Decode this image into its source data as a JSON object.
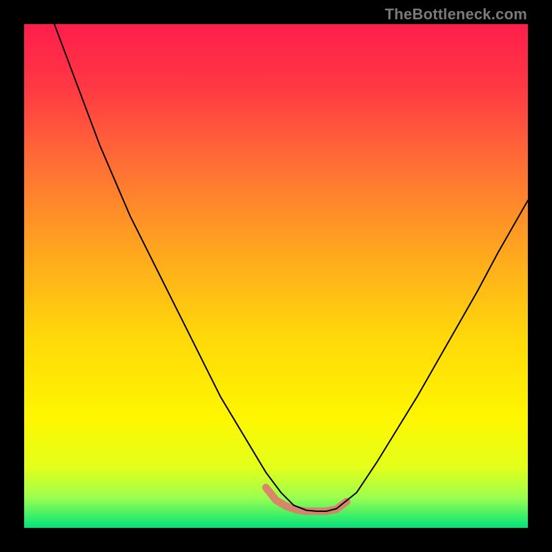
{
  "watermark": {
    "text": "TheBottleneck.com"
  },
  "chart_data": {
    "type": "line",
    "title": "",
    "xlabel": "",
    "ylabel": "",
    "grid": false,
    "legend": false,
    "xlim": [
      0,
      1
    ],
    "ylim": [
      0,
      1
    ],
    "background_gradient": {
      "direction": "vertical_top_to_bottom",
      "stops": [
        {
          "pos": 0.0,
          "color": "#ff1e4c"
        },
        {
          "pos": 0.12,
          "color": "#ff3744"
        },
        {
          "pos": 0.28,
          "color": "#ff6f35"
        },
        {
          "pos": 0.45,
          "color": "#ffa61f"
        },
        {
          "pos": 0.62,
          "color": "#ffd80a"
        },
        {
          "pos": 0.78,
          "color": "#fff600"
        },
        {
          "pos": 0.88,
          "color": "#e3ff1a"
        },
        {
          "pos": 0.94,
          "color": "#9bff4f"
        },
        {
          "pos": 1.0,
          "color": "#00e47a"
        }
      ]
    },
    "series": [
      {
        "name": "v-curve",
        "stroke": "#000000",
        "stroke_width": 2,
        "x": [
          0.06,
          0.09,
          0.12,
          0.15,
          0.18,
          0.21,
          0.24,
          0.27,
          0.3,
          0.33,
          0.36,
          0.39,
          0.42,
          0.45,
          0.48,
          0.51,
          0.535,
          0.56,
          0.58,
          0.6,
          0.62,
          0.66,
          0.7,
          0.74,
          0.78,
          0.82,
          0.86,
          0.9,
          0.94,
          0.98,
          1.0
        ],
        "y": [
          1.0,
          0.92,
          0.84,
          0.76,
          0.69,
          0.62,
          0.56,
          0.5,
          0.44,
          0.38,
          0.32,
          0.26,
          0.21,
          0.16,
          0.11,
          0.07,
          0.045,
          0.035,
          0.033,
          0.033,
          0.038,
          0.07,
          0.13,
          0.195,
          0.26,
          0.33,
          0.4,
          0.47,
          0.545,
          0.615,
          0.65
        ]
      }
    ],
    "annotations": [
      {
        "name": "valley-highlight",
        "stroke": "#e0796d",
        "stroke_width": 11,
        "opacity": 0.9,
        "x": [
          0.48,
          0.5,
          0.52,
          0.54,
          0.56,
          0.58,
          0.6,
          0.62,
          0.64
        ],
        "y": [
          0.08,
          0.055,
          0.043,
          0.036,
          0.033,
          0.033,
          0.033,
          0.037,
          0.052
        ]
      }
    ]
  }
}
